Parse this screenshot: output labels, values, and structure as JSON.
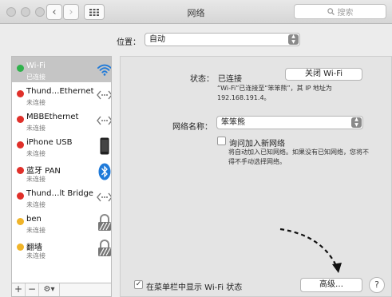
{
  "window": {
    "title": "网络"
  },
  "toolbar": {
    "back_icon": "chevron-left-icon",
    "forward_icon": "chevron-right-icon",
    "grid_icon": "grid-icon",
    "search_placeholder": "搜索"
  },
  "location": {
    "label": "位置：",
    "value": "自动"
  },
  "services": [
    {
      "name": "Wi-Fi",
      "status": "已连接",
      "dot_color": "#2fb24c",
      "icon": "wifi-icon",
      "selected": true
    },
    {
      "name": "Thund…Ethernet",
      "status": "未连接",
      "dot_color": "#e0302a",
      "icon": "ethernet-icon"
    },
    {
      "name": "MBBEthernet",
      "status": "未连接",
      "dot_color": "#e0302a",
      "icon": "ethernet-icon"
    },
    {
      "name": "iPhone USB",
      "status": "未连接",
      "dot_color": "#e0302a",
      "icon": "iphone-icon"
    },
    {
      "name": "蓝牙 PAN",
      "status": "未连接",
      "dot_color": "#e0302a",
      "icon": "bluetooth-icon"
    },
    {
      "name": "Thund…lt Bridge",
      "status": "未连接",
      "dot_color": "#e0302a",
      "icon": "ethernet-icon"
    },
    {
      "name": "ben",
      "status": "未连接",
      "dot_color": "#f0b429",
      "icon": "lock-icon"
    },
    {
      "name": "翻墙",
      "status": "未连接",
      "dot_color": "#f0b429",
      "icon": "lock-icon"
    }
  ],
  "sidebar_tools": {
    "add": "+",
    "remove": "−",
    "gear_icon": "gear-icon"
  },
  "details": {
    "status_label": "状态：",
    "status_value": "已连接",
    "wifi_button": "关闭 Wi-Fi",
    "status_desc_line1": "“Wi-Fi”已连接至“笨笨熊”，其 IP 地址为",
    "status_desc_line2": "192.168.191.4。",
    "network_name_label": "网络名称：",
    "network_name_value": "笨笨熊",
    "ask_join_label": "询问加入新网络",
    "ask_join_desc_line1": "将自动加入已知网络。如果没有已知网络，您将不",
    "ask_join_desc_line2": "得不手动选择网络。",
    "menubar_label": "在菜单栏中显示 Wi-Fi 状态",
    "advanced_button": "高级…",
    "help_button": "?"
  }
}
